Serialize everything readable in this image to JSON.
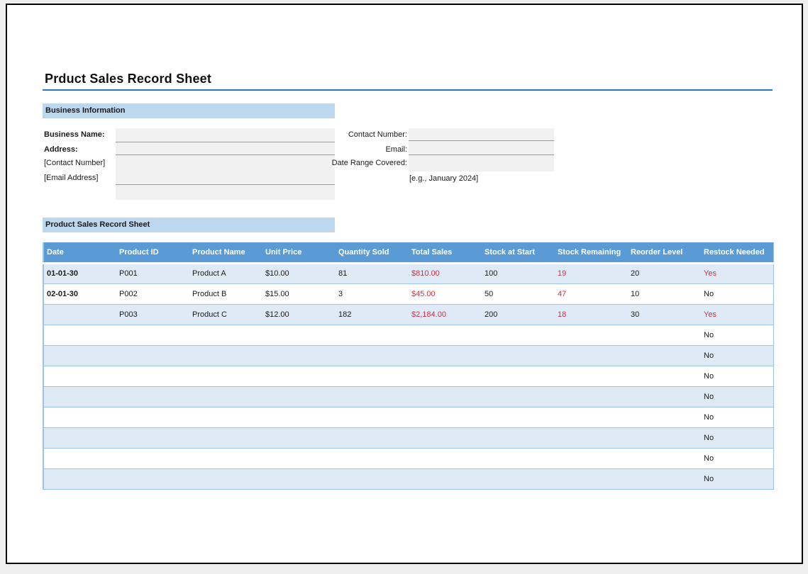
{
  "page": {
    "title": "Prduct Sales Record Sheet"
  },
  "colors": {
    "title_rule": "#2e75b6",
    "section_bar_bg": "#bdd7ee",
    "table_header_bg": "#5b9bd5",
    "row_alt_bg": "#deeaf6",
    "row_border": "#9dc3e6",
    "alert_red": "#cc3344",
    "field_bg": "#f1f1f1"
  },
  "business_info": {
    "section_title": "Business Information",
    "left_labels": [
      {
        "label": "Business Name:"
      },
      {
        "label": "Address:"
      },
      {
        "label": "[Contact Number]"
      },
      {
        "label": "[Email Address]"
      }
    ],
    "left_field_values": [
      "",
      "",
      "",
      ""
    ],
    "right_labels": [
      {
        "label": "Contact Number:"
      },
      {
        "label": "Email:"
      },
      {
        "label": "Date Range Covered:"
      }
    ],
    "right_field_values": [
      "",
      "",
      ""
    ],
    "hint": "[e.g., January 2024]"
  },
  "sales_table": {
    "section_title": "Product Sales Record Sheet",
    "columns": [
      "Date",
      "Product ID",
      "Product Name",
      "Unit Price",
      "Quantity Sold",
      "Total Sales",
      "Stock at Start",
      "Stock Remaining",
      "Reorder Level",
      "Restock Needed"
    ],
    "rows": [
      {
        "cells": [
          {
            "t": "01-01-30",
            "s": "bold"
          },
          {
            "t": "P001"
          },
          {
            "t": "Product A"
          },
          {
            "t": "$10.00"
          },
          {
            "t": "81"
          },
          {
            "t": "$810.00",
            "s": "red"
          },
          {
            "t": "100"
          },
          {
            "t": "19",
            "s": "red"
          },
          {
            "t": "20"
          },
          {
            "t": "Yes",
            "s": "red"
          }
        ]
      },
      {
        "cells": [
          {
            "t": "02-01-30",
            "s": "bold"
          },
          {
            "t": "P002"
          },
          {
            "t": "Product B"
          },
          {
            "t": "$15.00"
          },
          {
            "t": "3"
          },
          {
            "t": "$45.00",
            "s": "red"
          },
          {
            "t": "50"
          },
          {
            "t": "47",
            "s": "red"
          },
          {
            "t": "10"
          },
          {
            "t": "No"
          }
        ]
      },
      {
        "cells": [
          {
            "t": ""
          },
          {
            "t": "P003"
          },
          {
            "t": "Product C"
          },
          {
            "t": "$12.00"
          },
          {
            "t": "182"
          },
          {
            "t": "$2,184.00",
            "s": "red"
          },
          {
            "t": "200"
          },
          {
            "t": "18",
            "s": "red"
          },
          {
            "t": "30"
          },
          {
            "t": "Yes",
            "s": "red"
          }
        ]
      },
      {
        "cells": [
          {
            "t": ""
          },
          {
            "t": ""
          },
          {
            "t": ""
          },
          {
            "t": ""
          },
          {
            "t": ""
          },
          {
            "t": ""
          },
          {
            "t": ""
          },
          {
            "t": ""
          },
          {
            "t": ""
          },
          {
            "t": "No"
          }
        ]
      },
      {
        "cells": [
          {
            "t": ""
          },
          {
            "t": ""
          },
          {
            "t": ""
          },
          {
            "t": ""
          },
          {
            "t": ""
          },
          {
            "t": ""
          },
          {
            "t": ""
          },
          {
            "t": ""
          },
          {
            "t": ""
          },
          {
            "t": "No"
          }
        ]
      },
      {
        "cells": [
          {
            "t": ""
          },
          {
            "t": ""
          },
          {
            "t": ""
          },
          {
            "t": ""
          },
          {
            "t": ""
          },
          {
            "t": ""
          },
          {
            "t": ""
          },
          {
            "t": ""
          },
          {
            "t": ""
          },
          {
            "t": "No"
          }
        ]
      },
      {
        "cells": [
          {
            "t": ""
          },
          {
            "t": ""
          },
          {
            "t": ""
          },
          {
            "t": ""
          },
          {
            "t": ""
          },
          {
            "t": ""
          },
          {
            "t": ""
          },
          {
            "t": ""
          },
          {
            "t": ""
          },
          {
            "t": "No"
          }
        ]
      },
      {
        "cells": [
          {
            "t": ""
          },
          {
            "t": ""
          },
          {
            "t": ""
          },
          {
            "t": ""
          },
          {
            "t": ""
          },
          {
            "t": ""
          },
          {
            "t": ""
          },
          {
            "t": ""
          },
          {
            "t": ""
          },
          {
            "t": "No"
          }
        ]
      },
      {
        "cells": [
          {
            "t": ""
          },
          {
            "t": ""
          },
          {
            "t": ""
          },
          {
            "t": ""
          },
          {
            "t": ""
          },
          {
            "t": ""
          },
          {
            "t": ""
          },
          {
            "t": ""
          },
          {
            "t": ""
          },
          {
            "t": "No"
          }
        ]
      },
      {
        "cells": [
          {
            "t": ""
          },
          {
            "t": ""
          },
          {
            "t": ""
          },
          {
            "t": ""
          },
          {
            "t": ""
          },
          {
            "t": ""
          },
          {
            "t": ""
          },
          {
            "t": ""
          },
          {
            "t": ""
          },
          {
            "t": "No"
          }
        ]
      },
      {
        "cells": [
          {
            "t": ""
          },
          {
            "t": ""
          },
          {
            "t": ""
          },
          {
            "t": ""
          },
          {
            "t": ""
          },
          {
            "t": ""
          },
          {
            "t": ""
          },
          {
            "t": ""
          },
          {
            "t": ""
          },
          {
            "t": "No"
          }
        ]
      }
    ]
  }
}
